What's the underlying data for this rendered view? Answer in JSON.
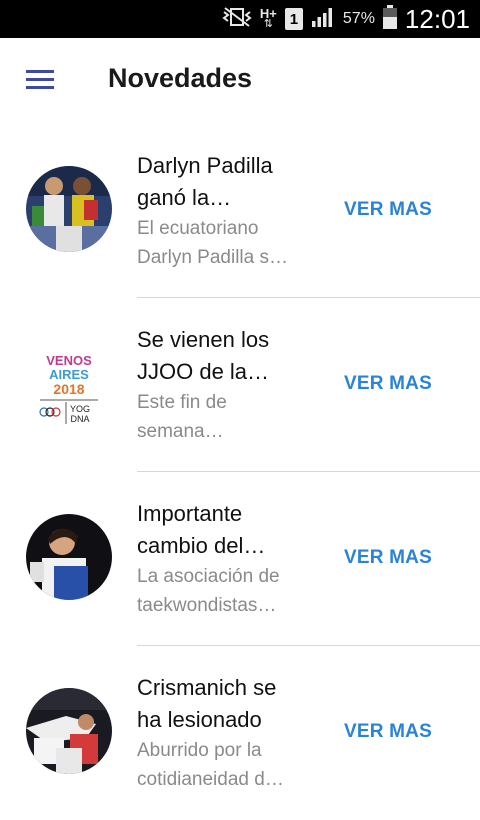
{
  "status_bar": {
    "battery_percent": "57%",
    "time": "12:01",
    "sim_slot": "1",
    "network_type": "H+",
    "icons": [
      "vibrate-off-icon",
      "data-arrows-icon",
      "sim-icon",
      "signal-icon",
      "battery-icon"
    ]
  },
  "app_bar": {
    "title": "Novedades",
    "menu_icon": "hamburger-menu-icon"
  },
  "colors": {
    "accent": "#2a83d8",
    "title_text": "#111111",
    "secondary_text": "#8a8a8a",
    "divider": "#d6d6d6",
    "status_bar_bg": "#000000"
  },
  "news": [
    {
      "title": "Darlyn Padilla\nganó la…",
      "description": "El ecuatoriano\nDarlyn Padilla s…",
      "action": "VER MAS",
      "image": "podium-photo"
    },
    {
      "title": "Se vienen los\nJJOO de la…",
      "description": "Este fin de\nsemana…",
      "action": "VER MAS",
      "image": "buenos-aires-2018-logo",
      "logo_text": "VENOS AIRES 2018",
      "logo_subtext": "YOG DNA"
    },
    {
      "title": "Importante\ncambio del…",
      "description": "La asociación de\ntaekwondistas…",
      "action": "VER MAS",
      "image": "taekwondo-athlete-photo"
    },
    {
      "title": "Crismanich se\nha lesionado",
      "description": "Aburrido por la\ncotidianeidad d…",
      "action": "VER MAS",
      "image": "taekwondo-kick-photo"
    }
  ]
}
